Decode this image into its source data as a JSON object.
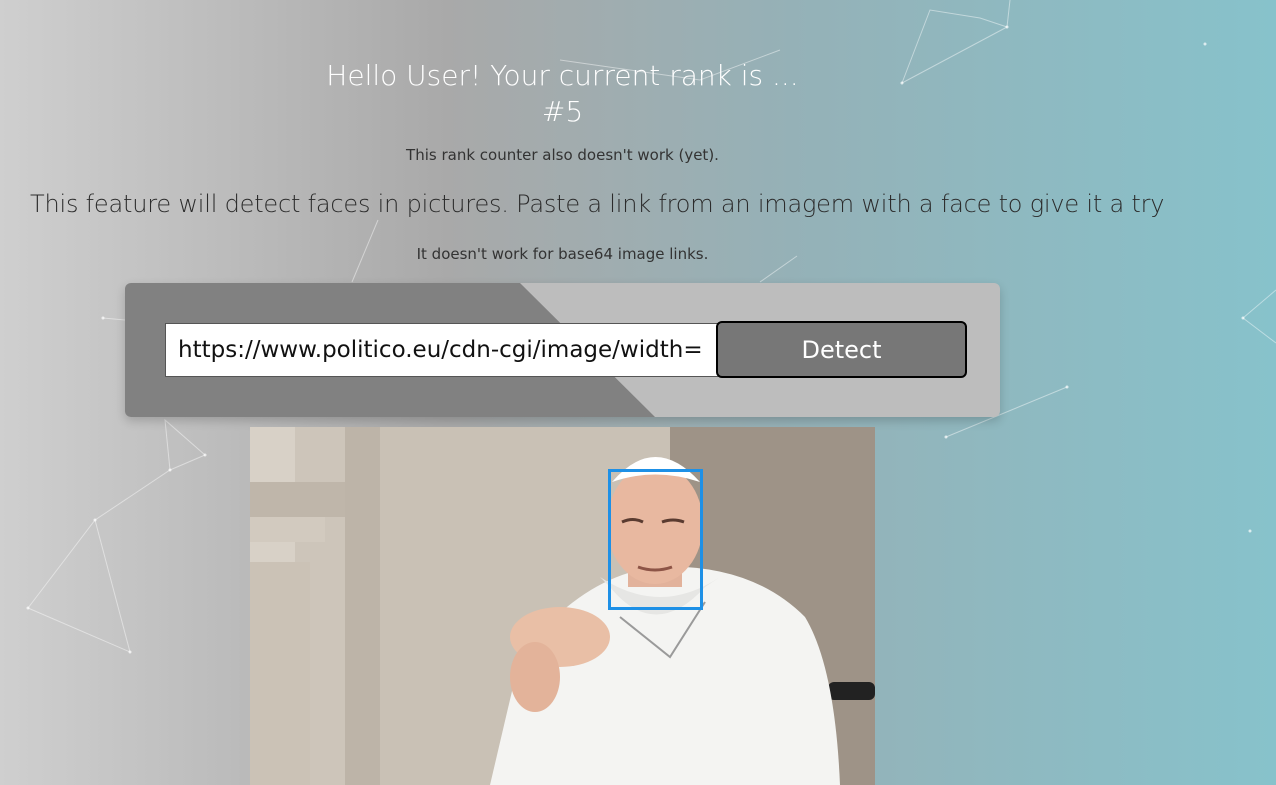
{
  "header": {
    "greeting": "Hello User! Your current rank is ...",
    "rank": "#5",
    "rank_note": "This rank counter also doesn't work (yet)."
  },
  "feature": {
    "description": "This feature will detect faces in pictures. Paste a link from an imagem with a face to give it a try",
    "note": "It doesn't work for base64 image links."
  },
  "form": {
    "url_value": "https://www.politico.eu/cdn-cgi/image/width=",
    "detect_label": "Detect"
  },
  "result": {
    "image_icon": "photo-of-person-icon",
    "face_box_color": "#1e90e6",
    "faces_detected": 1
  },
  "colors": {
    "panel_light": "#bdbdbd",
    "panel_dark": "#818181",
    "button_bg": "#777777"
  }
}
